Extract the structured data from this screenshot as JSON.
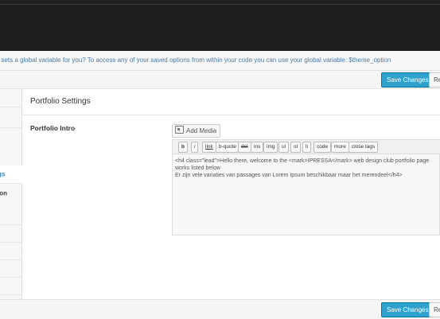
{
  "notice": {
    "text": "t sets a global variable for you? To access any of your saved options from within your code you can use your global variable: $theme_option"
  },
  "actions": {
    "save_label": "Save Changes",
    "reset_label": "Re"
  },
  "sidebar": {
    "items": [
      {
        "label": ""
      },
      {
        "label": ""
      },
      {
        "label": ""
      },
      {
        "label": "gs",
        "active": true
      },
      {
        "label": "ion"
      },
      {
        "label": ""
      },
      {
        "label": ""
      },
      {
        "label": ""
      },
      {
        "label": ""
      }
    ]
  },
  "main": {
    "section_title": "Portfolio Settings",
    "field_label": "Portfolio Intro",
    "add_media_label": "Add Media"
  },
  "toolbar": {
    "buttons": [
      "b",
      "i",
      "link",
      "b-quote",
      "del",
      "ins",
      "img",
      "ul",
      "ol",
      "li",
      "code",
      "more",
      "close tags"
    ]
  },
  "editor": {
    "lines": [
      "<h4 class=\"lead\">Hello there, welcome to the <mark>IPRESSA</mark> web design club portfolio page",
      "works listed below",
      "Er zijn vele variaties van passages van Lorem Ipsum beschikbaar maar het merendeel</h4>"
    ]
  },
  "colors": {
    "header_bg": "#1e1e1e",
    "primary_button": "#2ea2cc",
    "active_link": "#2a83c1",
    "notice_text": "#4a78a8"
  }
}
